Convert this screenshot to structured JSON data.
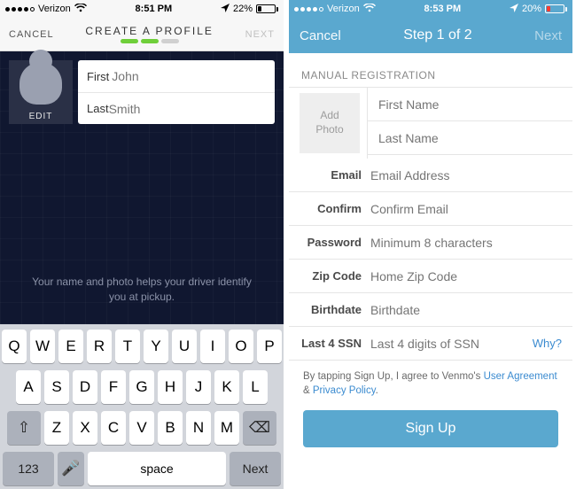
{
  "left": {
    "status": {
      "carrier": "Verizon",
      "time": "8:51 PM",
      "battery": "22%"
    },
    "nav": {
      "cancel": "CANCEL",
      "title": "CREATE A PROFILE",
      "next": "NEXT"
    },
    "avatar_edit": "EDIT",
    "fields": {
      "first_label": "First",
      "first_placeholder": "John",
      "last_label": "Last",
      "last_placeholder": "Smith"
    },
    "hint": "Your name and photo helps your driver identify you at pickup.",
    "keyboard": {
      "row1": [
        "Q",
        "W",
        "E",
        "R",
        "T",
        "Y",
        "U",
        "I",
        "O",
        "P"
      ],
      "row2": [
        "A",
        "S",
        "D",
        "F",
        "G",
        "H",
        "J",
        "K",
        "L"
      ],
      "row3": [
        "Z",
        "X",
        "C",
        "V",
        "B",
        "N",
        "M"
      ],
      "shift": "⇧",
      "del": "⌫",
      "num": "123",
      "mic": "🎤",
      "space": "space",
      "next": "Next"
    }
  },
  "right": {
    "status": {
      "carrier": "Verizon",
      "time": "8:53 PM",
      "battery": "20%"
    },
    "nav": {
      "cancel": "Cancel",
      "title": "Step 1 of 2",
      "next": "Next"
    },
    "section": "MANUAL REGISTRATION",
    "add_photo": "Add\nPhoto",
    "rows": {
      "first_ph": "First Name",
      "last_ph": "Last Name",
      "email_lbl": "Email",
      "email_ph": "Email Address",
      "confirm_lbl": "Confirm",
      "confirm_ph": "Confirm Email",
      "password_lbl": "Password",
      "password_ph": "Minimum 8 characters",
      "zip_lbl": "Zip Code",
      "zip_ph": "Home Zip Code",
      "birth_lbl": "Birthdate",
      "birth_ph": "Birthdate",
      "ssn_lbl": "Last 4 SSN",
      "ssn_ph": "Last 4 digits of SSN",
      "why": "Why?"
    },
    "agree_pre": "By tapping Sign Up, I agree to Venmo's ",
    "agree_link1": "User Agreement",
    "agree_mid": " & ",
    "agree_link2": "Privacy Policy",
    "agree_post": ".",
    "signup": "Sign Up"
  }
}
